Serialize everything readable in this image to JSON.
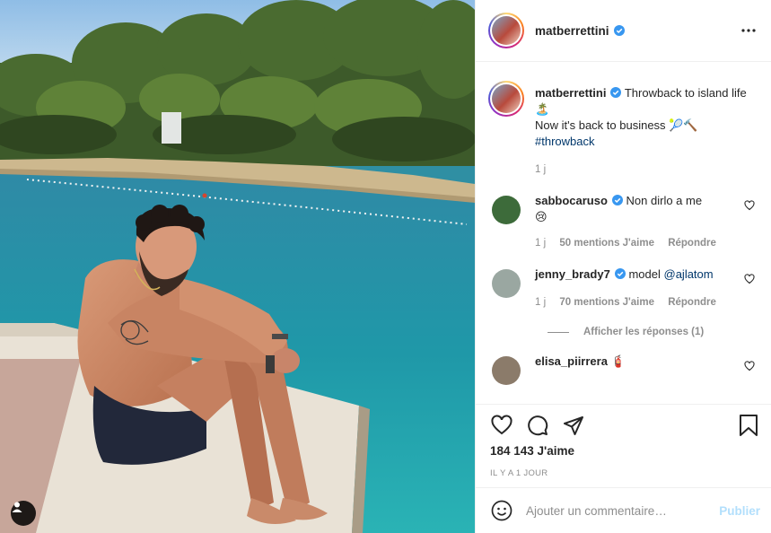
{
  "account": {
    "username": "matberrettini"
  },
  "caption": {
    "username": "matberrettini",
    "line1": "Throwback to island life🏝️",
    "line2": "Now it's back to business 🎾🔨",
    "hashtag": "#throwback",
    "time": "1 j"
  },
  "comments": [
    {
      "username": "sabbocaruso",
      "verified": true,
      "text": "Non dirlo a me",
      "emoji": "😢",
      "time": "1 j",
      "likes": "50 mentions J'aime",
      "reply": "Répondre",
      "avatar_color": "#3d6b3a"
    },
    {
      "username": "jenny_brady7",
      "verified": true,
      "text": "model",
      "mention": "@ajlatom",
      "time": "1 j",
      "likes": "70 mentions J'aime",
      "reply": "Répondre",
      "avatar_color": "#9aa7a1",
      "view_replies": "Afficher les réponses (1)"
    },
    {
      "username": "elisa_piirrera",
      "verified": false,
      "emoji": "🧯",
      "avatar_color": "#8b7b6a"
    }
  ],
  "actions": {
    "icons": [
      "heart-icon",
      "comment-icon",
      "share-icon",
      "bookmark-icon"
    ],
    "likes_count": "184 143 J'aime",
    "date": "IL Y A 1 JOUR"
  },
  "add_comment": {
    "placeholder": "Ajouter un commentaire…",
    "publish_label": "Publier"
  },
  "colors": {
    "verified_blue": "#3897f0",
    "link_blue": "#00376b",
    "muted_gray": "#8e8e8e",
    "publish_disabled": "#b2dffc"
  }
}
